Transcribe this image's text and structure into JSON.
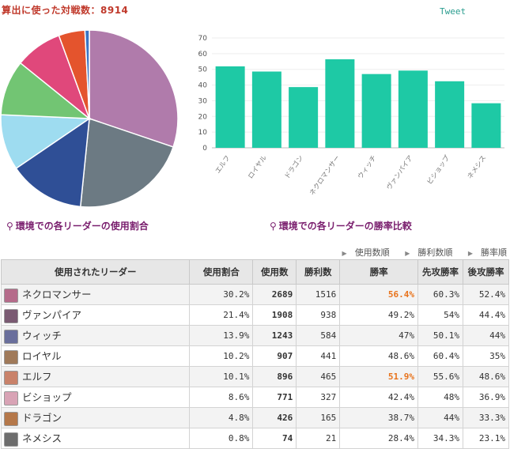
{
  "header": {
    "title": "算出に使った対戦数：8914",
    "tweet_label": "Tweet"
  },
  "captions": {
    "pie": "環境での各リーダーの使用割合",
    "bar": "環境での各リーダーの勝率比較"
  },
  "sort_links": [
    "使用数順",
    "勝利数順",
    "勝率順"
  ],
  "table": {
    "headers": [
      "使用されたリーダー",
      "使用割合",
      "使用数",
      "勝利数",
      "勝率",
      "先攻勝率",
      "後攻勝率"
    ],
    "rows": [
      {
        "leader": "ネクロマンサー",
        "share": "30.2%",
        "uses": "2689",
        "wins": "1516",
        "winrate": "56.4%",
        "first": "60.3%",
        "second": "52.4%",
        "highlight": true,
        "avatar_color": "#b56b8a"
      },
      {
        "leader": "ヴァンパイア",
        "share": "21.4%",
        "uses": "1908",
        "wins": "938",
        "winrate": "49.2%",
        "first": "54%",
        "second": "44.4%",
        "highlight": false,
        "avatar_color": "#7a5a72"
      },
      {
        "leader": "ウィッチ",
        "share": "13.9%",
        "uses": "1243",
        "wins": "584",
        "winrate": "47%",
        "first": "50.1%",
        "second": "44%",
        "highlight": false,
        "avatar_color": "#6a6f9c"
      },
      {
        "leader": "ロイヤル",
        "share": "10.2%",
        "uses": "907",
        "wins": "441",
        "winrate": "48.6%",
        "first": "60.4%",
        "second": "35%",
        "highlight": false,
        "avatar_color": "#a07a5a"
      },
      {
        "leader": "エルフ",
        "share": "10.1%",
        "uses": "896",
        "wins": "465",
        "winrate": "51.9%",
        "first": "55.6%",
        "second": "48.6%",
        "highlight": true,
        "avatar_color": "#c9826a"
      },
      {
        "leader": "ビショップ",
        "share": "8.6%",
        "uses": "771",
        "wins": "327",
        "winrate": "42.4%",
        "first": "48%",
        "second": "36.9%",
        "highlight": false,
        "avatar_color": "#d8a3b5"
      },
      {
        "leader": "ドラゴン",
        "share": "4.8%",
        "uses": "426",
        "wins": "165",
        "winrate": "38.7%",
        "first": "44%",
        "second": "33.3%",
        "highlight": false,
        "avatar_color": "#b5784a"
      },
      {
        "leader": "ネメシス",
        "share": "0.8%",
        "uses": "74",
        "wins": "21",
        "winrate": "28.4%",
        "first": "34.3%",
        "second": "23.1%",
        "highlight": false,
        "avatar_color": "#6d6d6d"
      }
    ]
  },
  "chart_data": [
    {
      "type": "pie",
      "categories": [
        "ネクロマンサー",
        "ヴァンパイア",
        "ウィッチ",
        "ロイヤル",
        "エルフ",
        "ビショップ",
        "ドラゴン",
        "ネメシス"
      ],
      "values": [
        30.2,
        21.4,
        13.9,
        10.2,
        10.1,
        8.6,
        4.8,
        0.8
      ],
      "colors": [
        "#b07bab",
        "#6c7a83",
        "#2f4f96",
        "#9edcf0",
        "#72c573",
        "#e0487b",
        "#e4542d",
        "#3a75c4"
      ]
    },
    {
      "type": "bar",
      "categories": [
        "エルフ",
        "ロイヤル",
        "ドラゴン",
        "ネクロマンサー",
        "ウィッチ",
        "ヴァンパイア",
        "ビショップ",
        "ネメシス"
      ],
      "values": [
        51.9,
        48.6,
        38.7,
        56.4,
        47,
        49.2,
        42.4,
        28.4
      ],
      "ylim": [
        0,
        70
      ],
      "yticks": [
        0,
        10,
        20,
        30,
        40,
        50,
        60,
        70
      ],
      "color": "#1ec9a5",
      "grid": true
    }
  ]
}
